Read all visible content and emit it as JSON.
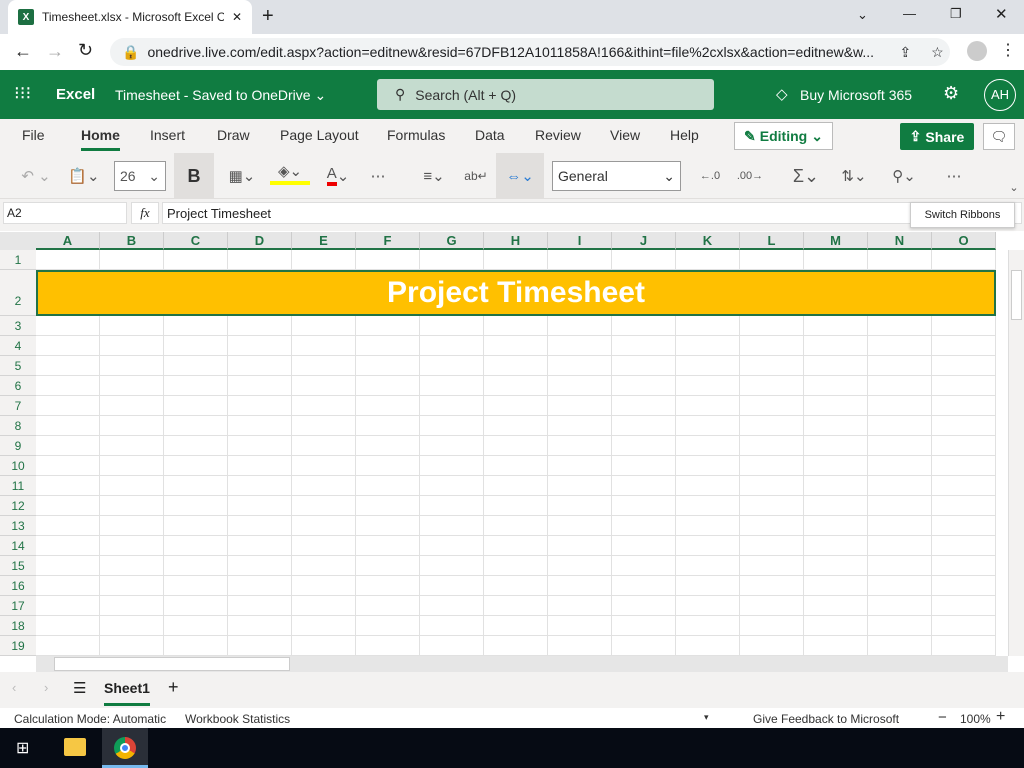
{
  "browser": {
    "tab_title": "Timesheet.xlsx - Microsoft Excel O",
    "url": "onedrive.live.com/edit.aspx?action=editnew&resid=67DFB12A1011858A!166&ithint=file%2cxlsx&action=editnew&w..."
  },
  "app": {
    "name": "Excel",
    "doc_title": "Timesheet",
    "doc_status": "Saved to OneDrive",
    "search_placeholder": "Search (Alt + Q)",
    "buy": "Buy Microsoft 365",
    "avatar": "AH"
  },
  "menu": [
    "File",
    "Home",
    "Insert",
    "Draw",
    "Page Layout",
    "Formulas",
    "Data",
    "Review",
    "View",
    "Help"
  ],
  "editing": "Editing",
  "share": "Share",
  "toolbar": {
    "font_size": "26",
    "bold": "B",
    "number_format": "General",
    "tooltip": "Switch Ribbons"
  },
  "formula_bar": {
    "name_box": "A2",
    "fx": "fx",
    "value": "Project Timesheet"
  },
  "columns": [
    "A",
    "B",
    "C",
    "D",
    "E",
    "F",
    "G",
    "H",
    "I",
    "J",
    "K",
    "L",
    "M",
    "N",
    "O"
  ],
  "rows": [
    "1",
    "2",
    "3",
    "4",
    "5",
    "6",
    "7",
    "8",
    "9",
    "10",
    "11",
    "12",
    "13",
    "14",
    "15",
    "16",
    "17",
    "18",
    "19"
  ],
  "cells": {
    "A2": "Project Timesheet"
  },
  "colors": {
    "header_fill": "#FFC000",
    "brand": "#107C41"
  },
  "sheets": [
    "Sheet1"
  ],
  "status": {
    "calc": "Calculation Mode: Automatic",
    "stats": "Workbook Statistics",
    "feedback": "Give Feedback to Microsoft",
    "zoom": "100%"
  }
}
